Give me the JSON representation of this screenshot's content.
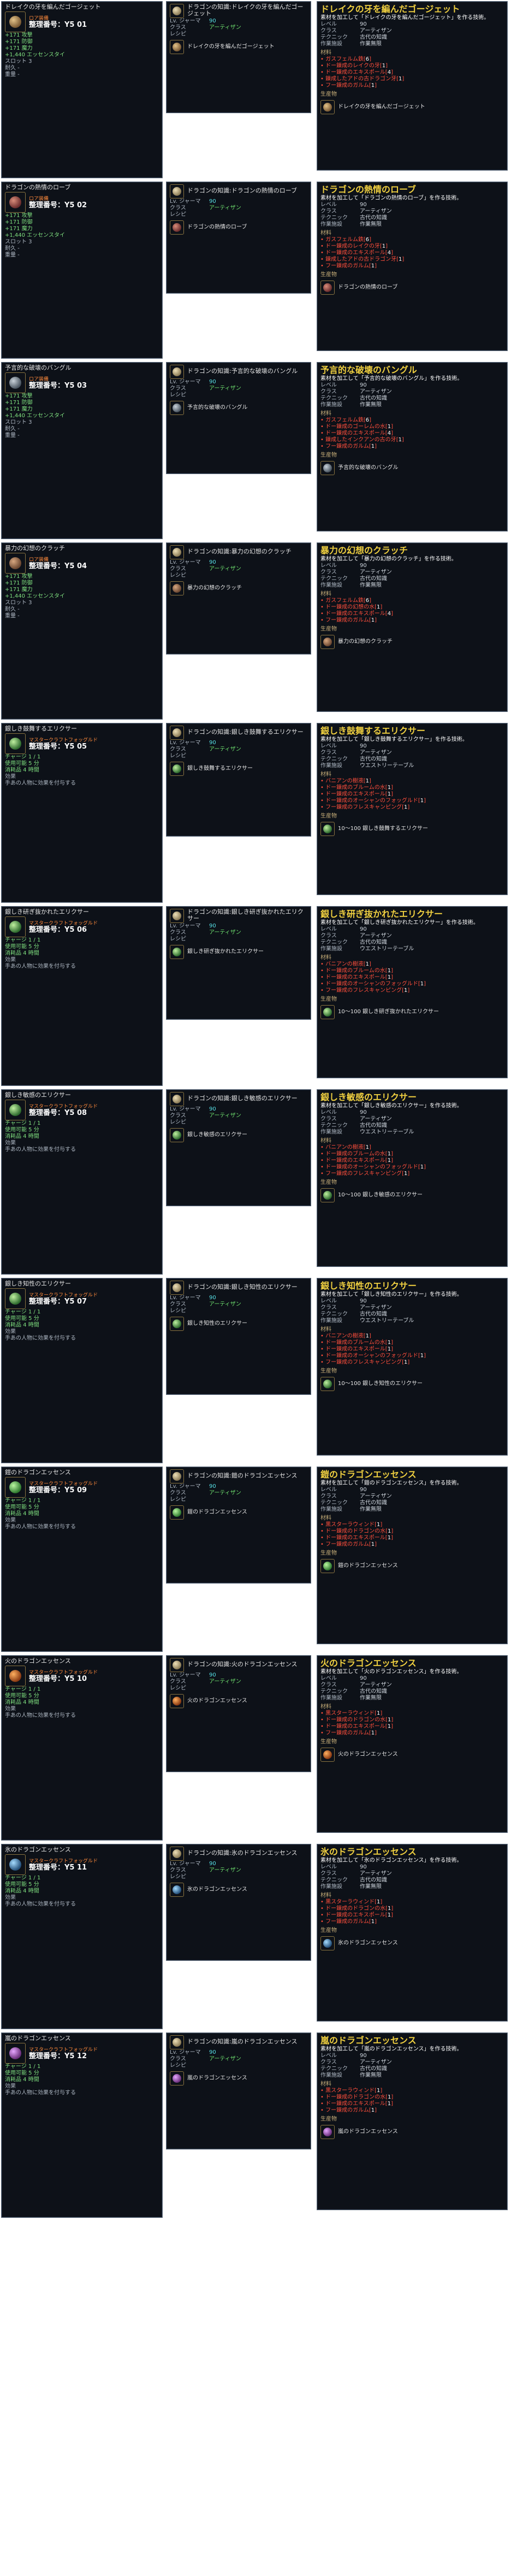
{
  "labels": {
    "serial": "整理番号：",
    "materials": "材料",
    "producer": "生産物",
    "level": "レベル",
    "class": "クラス",
    "technique": "テクニック",
    "workplace": "作業施設",
    "recipe_sub": "レシピ",
    "use_label": "使用",
    "crafting_skill": "製作スキル"
  },
  "entries": [
    {
      "tip_title": "ドレイクの牙を編んだゴージェット",
      "grade": "ロア装備",
      "serial": "整理番号：Y5 01",
      "stats": [
        "+171 攻撃",
        "+171 防御",
        "+171 魔力",
        "+1,440 エッセンスタイ"
      ],
      "bullets": [
        "スロット 3",
        "耐久 -",
        "重量 -"
      ],
      "recipe_title": "ドラゴンの知識:ドレイクの牙を編んだゴージェット",
      "recipe_level_label": "Lv. ジャーマ",
      "recipe_level": "90",
      "recipe_class": "アーティザン",
      "recipe_product": "ドレイクの牙を編んだゴージェット",
      "craft_title": "ドレイクの牙を編んだゴージェット",
      "craft_desc": "素材を加工して「ドレイクの牙を編んだゴージェット」を作る技術。",
      "craft_level": "90",
      "craft_class": "アーティザン",
      "craft_tech": "古代の知識",
      "craft_facility": "作業無限",
      "materials": [
        {
          "name": "ガスフェルム鉄",
          "count": "6"
        },
        {
          "name": "ドー錬成のレイクの牙",
          "count": "1"
        },
        {
          "name": "ドー錬成のエキスポール",
          "count": "4"
        },
        {
          "name": "錬成したアドの古ドラゴン牙",
          "count": "1"
        },
        {
          "name": "フー錬成のガルム",
          "count": "1"
        }
      ],
      "product": "ドレイクの牙を編んだゴージェット",
      "icon_c1": "#7a5a34",
      "icon_c2": "#e3c389"
    },
    {
      "tip_title": "ドラゴンの熱情のローブ",
      "grade": "ロア装備",
      "serial": "整理番号：Y5 02",
      "stats": [
        "+171 攻撃",
        "+171 防御",
        "+171 魔力",
        "+1,440 エッセンスタイ"
      ],
      "bullets": [
        "スロット 3",
        "耐久 -",
        "重量 -"
      ],
      "recipe_title": "ドラゴンの知識:ドラゴンの熱情のローブ",
      "recipe_level_label": "Lv. ジャーマ",
      "recipe_level": "90",
      "recipe_class": "アーティザン",
      "recipe_product": "ドラゴンの熱情のローブ",
      "craft_title": "ドラゴンの熱情のローブ",
      "craft_desc": "素材を加工して「ドラゴンの熱情のローブ」を作る技術。",
      "craft_level": "90",
      "craft_class": "アーティザン",
      "craft_tech": "古代の知識",
      "craft_facility": "作業無限",
      "materials": [
        {
          "name": "ガスフェルム鉄",
          "count": "6"
        },
        {
          "name": "ドー錬成のレイクの牙",
          "count": "1"
        },
        {
          "name": "ドー錬成のエキスポール",
          "count": "4"
        },
        {
          "name": "錬成したアドの古ドラゴン牙",
          "count": "1"
        },
        {
          "name": "フー錬成のガルム",
          "count": "1"
        }
      ],
      "product": "ドラゴンの熱情のローブ",
      "icon_c1": "#6b2d2d",
      "icon_c2": "#d88c7a"
    },
    {
      "tip_title": "予言的な破壊のバングル",
      "grade": "ロア装備",
      "serial": "整理番号：Y5 03",
      "stats": [
        "+171 攻撃",
        "+171 防御",
        "+171 魔力",
        "+1,440 エッセンスタイ"
      ],
      "bullets": [
        "スロット 3",
        "耐久 -",
        "重量 -"
      ],
      "recipe_title": "ドラゴンの知識:予言的な破壊のバングル",
      "recipe_level_label": "Lv. ジャーマ",
      "recipe_level": "90",
      "recipe_class": "アーティザン",
      "recipe_product": "予言的な破壊のバングル",
      "craft_title": "予言的な破壊のバングル",
      "craft_desc": "素材を加工して「予言的な破壊のバングル」を作る技術。",
      "craft_level": "90",
      "craft_class": "アーティザン",
      "craft_tech": "古代の知識",
      "craft_facility": "作業無限",
      "materials": [
        {
          "name": "ガスフェルム鉄",
          "count": "6"
        },
        {
          "name": "ドー錬成のゴーレムの水",
          "count": "1"
        },
        {
          "name": "ドー錬成のエキスポール",
          "count": "4"
        },
        {
          "name": "錬成したインクアンの古の牙",
          "count": "1"
        },
        {
          "name": "フー錬成のガルム",
          "count": "1"
        }
      ],
      "product": "予言的な破壊のバングル",
      "icon_c1": "#4a5560",
      "icon_c2": "#c9d2da"
    },
    {
      "tip_title": "暴力の幻想のクラッチ",
      "grade": "ロア装備",
      "serial": "整理番号：Y5 04",
      "stats": [
        "+171 攻撃",
        "+171 防御",
        "+171 魔力",
        "+1,440 エッセンスタイ"
      ],
      "bullets": [
        "スロット 3",
        "耐久 -",
        "重量 -"
      ],
      "recipe_title": "ドラゴンの知識:暴力の幻想のクラッチ",
      "recipe_level_label": "Lv. ジャーマ",
      "recipe_level": "90",
      "recipe_class": "アーティザン",
      "recipe_product": "暴力の幻想のクラッチ",
      "craft_title": "暴力の幻想のクラッチ",
      "craft_desc": "素材を加工して「暴力の幻想のクラッチ」を作る技術。",
      "craft_level": "90",
      "craft_class": "アーティザン",
      "craft_tech": "古代の知識",
      "craft_facility": "作業無限",
      "materials": [
        {
          "name": "ガスフェルム鉄",
          "count": "6"
        },
        {
          "name": "ドー錬成の幻想の水",
          "count": "1"
        },
        {
          "name": "ドー錬成のエキスポール",
          "count": "4"
        },
        {
          "name": "フー錬成のガルム",
          "count": "1"
        }
      ],
      "product": "暴力の幻想のクラッチ",
      "icon_c1": "#6a4630",
      "icon_c2": "#d7a780"
    },
    {
      "tip_title": "銀しき鼓舞するエリクサー",
      "grade": "マスタークラフトフォッグルド",
      "serial": "整理番号：Y5 05",
      "stats": [
        "チャージ 1 / 1",
        "使用可能 5 分",
        "消耗品 4 時間"
      ],
      "bullets": [
        "効果",
        "手あの人物に効果を付与する"
      ],
      "recipe_title": "ドラゴンの知識:銀しき鼓舞するエリクサー",
      "recipe_level_label": "Lv. ジャーマ",
      "recipe_level": "90",
      "recipe_class": "アーティザン",
      "recipe_product": "銀しき鼓舞するエリクサー",
      "craft_title": "銀しき鼓舞するエリクサー",
      "craft_desc": "素材を加工して「銀しき鼓舞するエリクサー」を作る技術。",
      "craft_level": "90",
      "craft_class": "アーティザン",
      "craft_tech": "古代の知識",
      "craft_facility": "ウエストリーテーブル",
      "materials": [
        {
          "name": "バニアンの樹液",
          "count": "1"
        },
        {
          "name": "ドー錬成のブルームの水",
          "count": "1"
        },
        {
          "name": "ドー錬成のエキスポール",
          "count": "1"
        },
        {
          "name": "ドー錬成のオーシャンのフォッグルド",
          "count": "1"
        },
        {
          "name": "フー錬成のフレスキャンピング",
          "count": "1"
        }
      ],
      "product": "10〜100 銀しき鼓舞するエリクサー",
      "icon_c1": "#2d6a2d",
      "icon_c2": "#bff0a0"
    },
    {
      "tip_title": "銀しき研ぎ抜かれたエリクサー",
      "grade": "マスタークラフトフォッグルド",
      "serial": "整理番号：Y5 06",
      "stats": [
        "チャージ 1 / 1",
        "使用可能 5 分",
        "消耗品 4 時間"
      ],
      "bullets": [
        "効果",
        "手あの人物に効果を付与する"
      ],
      "recipe_title": "ドラゴンの知識:銀しき研ぎ抜かれたエリクサー",
      "recipe_level_label": "Lv. ジャーマ",
      "recipe_level": "90",
      "recipe_class": "アーティザン",
      "recipe_product": "銀しき研ぎ抜かれたエリクサー",
      "craft_title": "銀しき研ぎ抜かれたエリクサー",
      "craft_desc": "素材を加工して「銀しき研ぎ抜かれたエリクサー」を作る技術。",
      "craft_level": "90",
      "craft_class": "アーティザン",
      "craft_tech": "古代の知識",
      "craft_facility": "ウエストリーテーブル",
      "materials": [
        {
          "name": "バニアンの樹液",
          "count": "1"
        },
        {
          "name": "ドー錬成のブルームの水",
          "count": "1"
        },
        {
          "name": "ドー錬成のエキスポール",
          "count": "1"
        },
        {
          "name": "ドー錬成のオーシャンのフォッグルド",
          "count": "1"
        },
        {
          "name": "フー錬成のフレスキャンピング",
          "count": "1"
        }
      ],
      "product": "10〜100 銀しき研ぎ抜かれたエリクサー",
      "icon_c1": "#2d6a2d",
      "icon_c2": "#bff0a0"
    },
    {
      "tip_title": "銀しき敏感のエリクサー",
      "grade": "マスタークラフトフォッグルド",
      "serial": "整理番号：Y5 08",
      "stats": [
        "チャージ 1 / 1",
        "使用可能 5 分",
        "消耗品 4 時間"
      ],
      "bullets": [
        "効果",
        "手あの人物に効果を付与する"
      ],
      "recipe_title": "ドラゴンの知識:銀しき敏感のエリクサー",
      "recipe_level_label": "Lv. ジャーマ",
      "recipe_level": "90",
      "recipe_class": "アーティザン",
      "recipe_product": "銀しき敏感のエリクサー",
      "craft_title": "銀しき敏感のエリクサー",
      "craft_desc": "素材を加工して「銀しき敏感のエリクサー」を作る技術。",
      "craft_level": "90",
      "craft_class": "アーティザン",
      "craft_tech": "古代の知識",
      "craft_facility": "ウエストリーテーブル",
      "materials": [
        {
          "name": "バニアンの樹液",
          "count": "1"
        },
        {
          "name": "ドー錬成のブルームの水",
          "count": "1"
        },
        {
          "name": "ドー錬成のエキスポール",
          "count": "1"
        },
        {
          "name": "ドー錬成のオーシャンのフォッグルド",
          "count": "1"
        },
        {
          "name": "フー錬成のフレスキャンピング",
          "count": "1"
        }
      ],
      "product": "10〜100 銀しき敏感のエリクサー",
      "icon_c1": "#2d6a2d",
      "icon_c2": "#bff0a0"
    },
    {
      "tip_title": "銀しき知性のエリクサー",
      "grade": "マスタークラフトフォッグルド",
      "serial": "整理番号：Y5 07",
      "stats": [
        "チャージ 1 / 1",
        "使用可能 5 分",
        "消耗品 4 時間"
      ],
      "bullets": [
        "効果",
        "手あの人物に効果を付与する"
      ],
      "recipe_title": "ドラゴンの知識:銀しき知性のエリクサー",
      "recipe_level_label": "Lv. ジャーマ",
      "recipe_level": "90",
      "recipe_class": "アーティザン",
      "recipe_product": "銀しき知性のエリクサー",
      "craft_title": "銀しき知性のエリクサー",
      "craft_desc": "素材を加工して「銀しき知性のエリクサー」を作る技術。",
      "craft_level": "90",
      "craft_class": "アーティザン",
      "craft_tech": "古代の知識",
      "craft_facility": "ウエストリーテーブル",
      "materials": [
        {
          "name": "バニアンの樹液",
          "count": "1"
        },
        {
          "name": "ドー錬成のブルームの水",
          "count": "1"
        },
        {
          "name": "ドー錬成のエキスポール",
          "count": "1"
        },
        {
          "name": "ドー錬成のオーシャンのフォッグルド",
          "count": "1"
        },
        {
          "name": "フー錬成のフレスキャンピング",
          "count": "1"
        }
      ],
      "product": "10〜100 銀しき知性のエリクサー",
      "icon_c1": "#2d6a2d",
      "icon_c2": "#bff0a0"
    },
    {
      "tip_title": "鎧のドラゴンエッセンス",
      "grade": "マスタークラフトフォッグルド",
      "serial": "整理番号：Y5 09",
      "stats": [
        "チャージ 1 / 1",
        "使用可能 5 分",
        "消耗品 4 時間"
      ],
      "bullets": [
        "効果",
        "手あの人物に効果を付与する"
      ],
      "recipe_title": "ドラゴンの知識:鎧のドラゴンエッセンス",
      "recipe_level_label": "Lv. ジャーマ",
      "recipe_level": "90",
      "recipe_class": "アーティザン",
      "recipe_product": "鎧のドラゴンエッセンス",
      "craft_title": "鎧のドラゴンエッセンス",
      "craft_desc": "素材を加工して「鎧のドラゴンエッセンス」を作る技術。",
      "craft_level": "90",
      "craft_class": "アーティザン",
      "craft_tech": "古代の知識",
      "craft_facility": "作業無限",
      "materials": [
        {
          "name": "黒スターラウィンド",
          "count": "1"
        },
        {
          "name": "ドー錬成のドラゴンの水",
          "count": "1"
        },
        {
          "name": "ドー錬成のエキスポール",
          "count": "1"
        },
        {
          "name": "フー錬成のガルム",
          "count": "1"
        }
      ],
      "product": "鎧のドラゴンエッセンス",
      "icon_c1": "#2f7a2f",
      "icon_c2": "#b9f7a0"
    },
    {
      "tip_title": "火のドラゴンエッセンス",
      "grade": "マスタークラフトフォッグルド",
      "serial": "整理番号：Y5 10",
      "stats": [
        "チャージ 1 / 1",
        "使用可能 5 分",
        "消耗品 4 時間"
      ],
      "bullets": [
        "効果",
        "手あの人物に効果を付与する"
      ],
      "recipe_title": "ドラゴンの知識:火のドラゴンエッセンス",
      "recipe_level_label": "Lv. ジャーマ",
      "recipe_level": "90",
      "recipe_class": "アーティザン",
      "recipe_product": "火のドラゴンエッセンス",
      "craft_title": "火のドラゴンエッセンス",
      "craft_desc": "素材を加工して「火のドラゴンエッセンス」を作る技術。",
      "craft_level": "90",
      "craft_class": "アーティザン",
      "craft_tech": "古代の知識",
      "craft_facility": "作業無限",
      "materials": [
        {
          "name": "黒スターラウィンド",
          "count": "1"
        },
        {
          "name": "ドー錬成のドラゴンの水",
          "count": "1"
        },
        {
          "name": "ドー錬成のエキスポール",
          "count": "1"
        },
        {
          "name": "フー錬成のガルム",
          "count": "1"
        }
      ],
      "product": "火のドラゴンエッセンス",
      "icon_c1": "#8a3a12",
      "icon_c2": "#ffb060"
    },
    {
      "tip_title": "氷のドラゴンエッセンス",
      "grade": "マスタークラフトフォッグルド",
      "serial": "整理番号：Y5 11",
      "stats": [
        "チャージ 1 / 1",
        "使用可能 5 分",
        "消耗品 4 時間"
      ],
      "bullets": [
        "効果",
        "手あの人物に効果を付与する"
      ],
      "recipe_title": "ドラゴンの知識:氷のドラゴンエッセンス",
      "recipe_level_label": "Lv. ジャーマ",
      "recipe_level": "90",
      "recipe_class": "アーティザン",
      "recipe_product": "氷のドラゴンエッセンス",
      "craft_title": "氷のドラゴンエッセンス",
      "craft_desc": "素材を加工して「氷のドラゴンエッセンス」を作る技術。",
      "craft_level": "90",
      "craft_class": "アーティザン",
      "craft_tech": "古代の知識",
      "craft_facility": "作業無限",
      "materials": [
        {
          "name": "黒スターラウィンド",
          "count": "1"
        },
        {
          "name": "ドー錬成のドラゴンの水",
          "count": "1"
        },
        {
          "name": "ドー錬成のエキスポール",
          "count": "1"
        },
        {
          "name": "フー錬成のガルム",
          "count": "1"
        }
      ],
      "product": "氷のドラゴンエッセンス",
      "icon_c1": "#24507a",
      "icon_c2": "#a6dcff"
    },
    {
      "tip_title": "嵐のドラゴンエッセンス",
      "grade": "マスタークラフトフォッグルド",
      "serial": "整理番号：Y5 12",
      "stats": [
        "チャージ 1 / 1",
        "使用可能 5 分",
        "消耗品 4 時間"
      ],
      "bullets": [
        "効果",
        "手あの人物に効果を付与する"
      ],
      "recipe_title": "ドラゴンの知識:嵐のドラゴンエッセンス",
      "recipe_level_label": "Lv. ジャーマ",
      "recipe_level": "90",
      "recipe_class": "アーティザン",
      "recipe_product": "嵐のドラゴンエッセンス",
      "craft_title": "嵐のドラゴンエッセンス",
      "craft_desc": "素材を加工して「嵐のドラゴンエッセンス」を作る技術。",
      "craft_level": "90",
      "craft_class": "アーティザン",
      "craft_tech": "古代の知識",
      "craft_facility": "作業無限",
      "materials": [
        {
          "name": "黒スターラウィンド",
          "count": "1"
        },
        {
          "name": "ドー錬成のドラゴンの水",
          "count": "1"
        },
        {
          "name": "ドー錬成のエキスポール",
          "count": "1"
        },
        {
          "name": "フー錬成のガルム",
          "count": "1"
        }
      ],
      "product": "嵐のドラゴンエッセンス",
      "icon_c1": "#6a2f7a",
      "icon_c2": "#e6a6ff"
    }
  ]
}
